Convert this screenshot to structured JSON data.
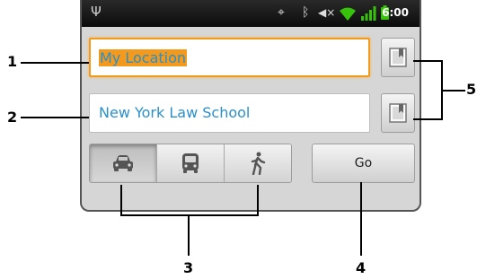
{
  "status_bar": {
    "time": "6:00",
    "icons": [
      "usb-icon",
      "gps-icon",
      "bluetooth-icon",
      "volume-muted-icon",
      "wifi-icon",
      "signal-icon",
      "battery-icon"
    ]
  },
  "directions": {
    "from_value": "My Location",
    "to_value": "New York Law School",
    "modes": [
      "car-icon",
      "bus-icon",
      "walk-icon"
    ],
    "active_mode": "car-icon",
    "go_label": "Go"
  },
  "callouts": [
    "1",
    "2",
    "3",
    "4",
    "5"
  ],
  "colors": {
    "accent_orange": "#f39a1c",
    "text_blue": "#2b8fca",
    "status_bar": "#111111",
    "wifi_green": "#37c20b"
  }
}
